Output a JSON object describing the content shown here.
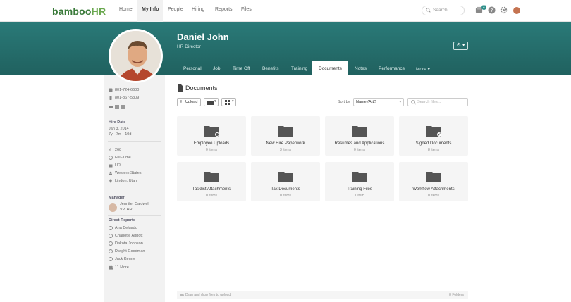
{
  "app": {
    "logo_main": "bamboo",
    "logo_hr": "HR"
  },
  "nav": {
    "items": [
      "Home",
      "My Info",
      "People",
      "Hiring",
      "Reports",
      "Files"
    ],
    "active": "My Info",
    "search_placeholder": "Search...",
    "notification_count": "2"
  },
  "profile": {
    "name": "Daniel John",
    "title": "HR Director",
    "tabs": [
      "Personal",
      "Job",
      "Time Off",
      "Benefits",
      "Training",
      "Documents",
      "Notes",
      "Performance",
      "More ▾"
    ],
    "active_tab": "Documents"
  },
  "sidebar": {
    "phone_work": "801-724-6600",
    "phone_mobile": "801-867-5309",
    "hire_date_label": "Hire Date",
    "hire_date": "Jan 3, 2014",
    "hire_duration": "7y - 7m - 10d",
    "details": [
      "268",
      "Full-Time",
      "HR",
      "Western States",
      "Lindon, Utah"
    ],
    "manager_label": "Manager",
    "manager_name": "Jennifer Caldwell",
    "manager_title": "VP, HR",
    "direct_reports_label": "Direct Reports",
    "direct_reports": [
      "Ana Delgado",
      "Charlotte Abbott",
      "Dakota Johnson",
      "Dwight Goodman",
      "Jack Kenny",
      "11 More..."
    ]
  },
  "documents": {
    "title": "Documents",
    "upload_label": "Upload",
    "sort_label": "Sort by",
    "sort_value": "Name (A-Z)",
    "search_placeholder": "Search files...",
    "folders": [
      {
        "name": "Employee Uploads",
        "count": "0 items"
      },
      {
        "name": "New Hire Paperwork",
        "count": "3 items"
      },
      {
        "name": "Resumes and Applications",
        "count": "0 items"
      },
      {
        "name": "Signed Documents",
        "count": "8 items"
      },
      {
        "name": "Tasklist Attachments",
        "count": "0 items"
      },
      {
        "name": "Tax Documents",
        "count": "0 items"
      },
      {
        "name": "Training Files",
        "count": "1 item"
      },
      {
        "name": "Workflow Attachments",
        "count": "0 items"
      }
    ],
    "drop_hint": "Drag and drop files to upload",
    "folder_total": "8 Folders"
  },
  "colors": {
    "header_teal": "#2a7a78",
    "accent_green": "#6aa84f",
    "folder_gray": "#555555"
  }
}
